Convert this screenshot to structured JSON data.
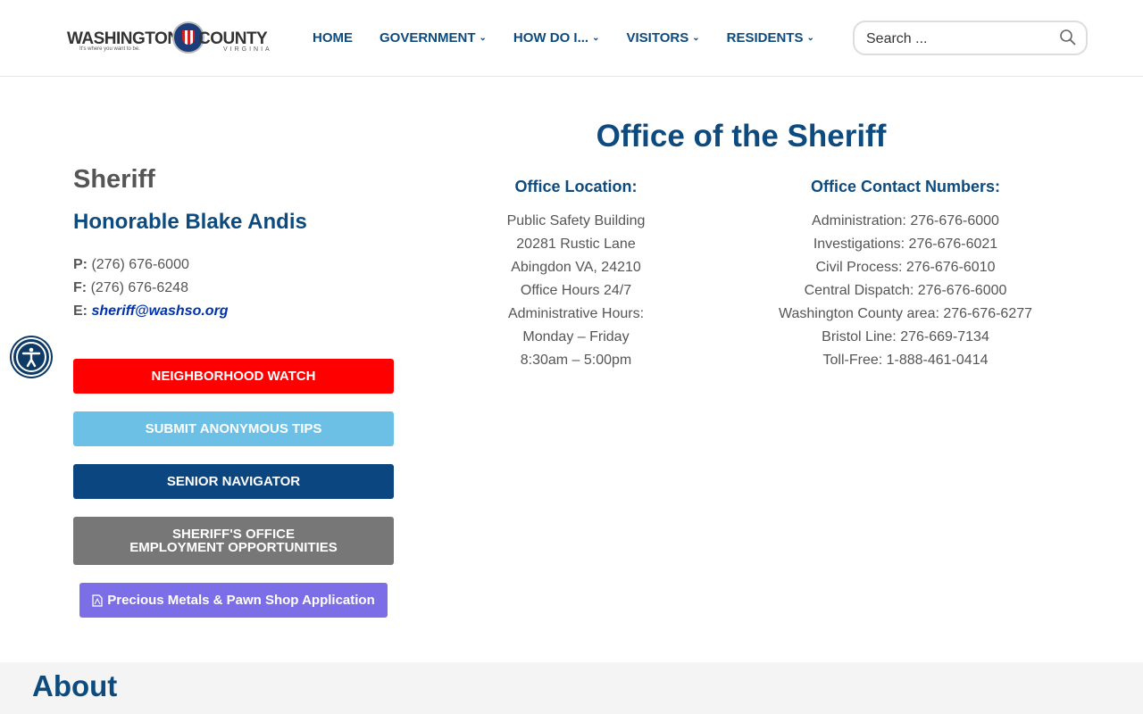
{
  "header": {
    "logo": {
      "left": "WASHINGTON",
      "right": "COUNTY",
      "tagline": "It's where you want to be.",
      "state": "VIRGINIA"
    },
    "nav": [
      {
        "label": "HOME",
        "dropdown": false
      },
      {
        "label": "GOVERNMENT",
        "dropdown": true
      },
      {
        "label": "HOW DO I...",
        "dropdown": true
      },
      {
        "label": "VISITORS",
        "dropdown": true
      },
      {
        "label": "RESIDENTS",
        "dropdown": true
      }
    ],
    "search": {
      "placeholder": "Search ..."
    }
  },
  "sidebar": {
    "heading": "Sheriff",
    "name": "Honorable Blake Andis",
    "phone_label": "P:",
    "phone": "(276) 676-6000",
    "fax_label": "F:",
    "fax": "(276) 676-6248",
    "email_label": "E:",
    "email": " sheriff@washso.org",
    "buttons": [
      {
        "label": "NEIGHBORHOOD WATCH",
        "color": "#ff0000"
      },
      {
        "label": "SUBMIT ANONYMOUS TIPS",
        "color": "#6cc0e5"
      },
      {
        "label": "SENIOR NAVIGATOR",
        "color": "#0b4680"
      },
      {
        "label": "SHERIFF'S OFFICE EMPLOYMENT OPPORTUNITIES",
        "color": "#777777"
      },
      {
        "label": "Precious Metals & Pawn Shop Application",
        "color": "#7b6ee6",
        "icon": "pdf-icon"
      }
    ]
  },
  "main": {
    "title": "Office of the Sheriff",
    "location": {
      "heading": "Office Location:",
      "lines": [
        "Public Safety Building",
        "20281 Rustic Lane",
        "Abingdon VA, 24210",
        "Office Hours 24/7",
        "Administrative Hours:",
        "Monday – Friday",
        "8:30am – 5:00pm"
      ]
    },
    "contacts": {
      "heading": "Office Contact Numbers:",
      "lines": [
        "Administration: 276-676-6000",
        "Investigations: 276-676-6021",
        "Civil Process: 276-676-6010",
        "Central Dispatch: 276-676-6000",
        "Washington County area: 276-676-6277",
        "Bristol Line: 276-669-7134",
        "Toll-Free: 1-888-461-0414"
      ]
    }
  },
  "about": {
    "heading": "About"
  }
}
